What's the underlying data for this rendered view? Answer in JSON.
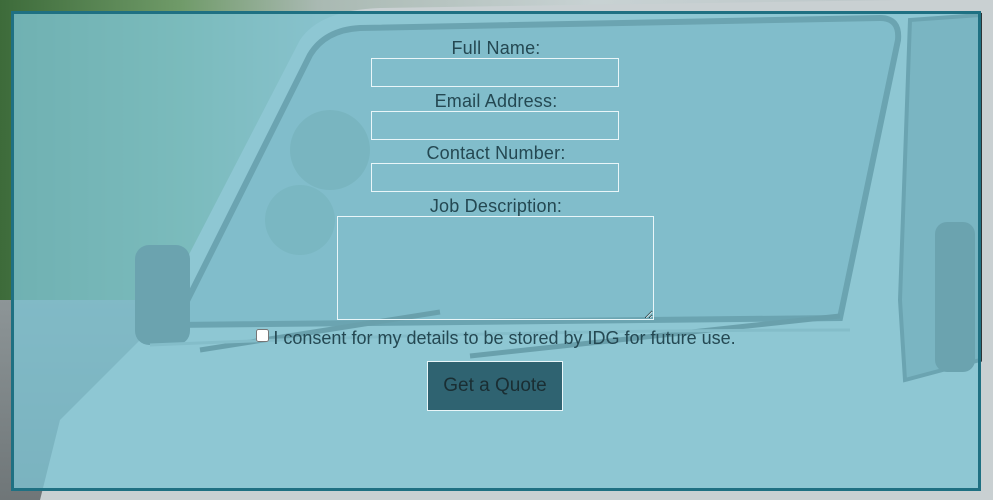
{
  "form": {
    "full_name_label": "Full Name:",
    "email_label": "Email Address:",
    "phone_label": "Contact Number:",
    "job_label": "Job Description:",
    "full_name_value": "",
    "email_value": "",
    "phone_value": "",
    "job_value": "",
    "consent_text": "I consent for my details to be stored by IDG for future use.",
    "consent_checked": false,
    "submit_label": "Get a Quote"
  },
  "colors": {
    "panel_border": "#1f7082",
    "panel_fill": "#7dc4d3",
    "text": "#244852",
    "button": "#2f6371"
  }
}
